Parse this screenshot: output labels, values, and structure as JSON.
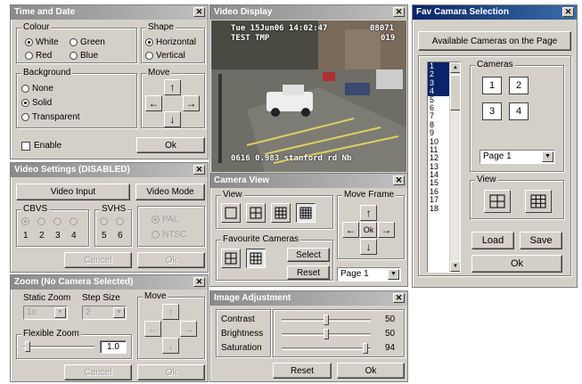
{
  "time_date": {
    "title": "Time and Date",
    "colour_label": "Colour",
    "colours": [
      "White",
      "Green",
      "Red",
      "Blue"
    ],
    "shape_label": "Shape",
    "shapes": [
      "Horizontal",
      "Vertical"
    ],
    "background_label": "Background",
    "backgrounds": [
      "None",
      "Solid",
      "Transparent"
    ],
    "move_label": "Move",
    "enable_label": "Enable",
    "ok_label": "Ok"
  },
  "video_display": {
    "title": "Video Display",
    "overlay_line1": "Tue 15Jun06 14:02:47 ",
    "overlay_line1_right": "08071",
    "overlay_line2": "TEST    TMP",
    "overlay_line2_right": "019",
    "overlay_bottom": "0616  0.983 stanford rd Nb"
  },
  "fav_camera": {
    "title": "Fav Camara Selection",
    "available_button": "Available Cameras on the Page",
    "list_items": [
      "1",
      "2",
      "3",
      "4",
      "5",
      "6",
      "7",
      "8",
      "9",
      "10",
      "11",
      "12",
      "13",
      "14",
      "15",
      "16",
      "17",
      "18"
    ],
    "selected_items": [
      "1",
      "2",
      "3",
      "4"
    ],
    "cameras_label": "Cameras",
    "camera_slots": [
      "1",
      "2",
      "3",
      "4"
    ],
    "page_select": "Page 1",
    "view_label": "View",
    "load_label": "Load",
    "save_label": "Save",
    "ok_label": "Ok"
  },
  "video_settings": {
    "title": "Video Settings (DISABLED)",
    "video_input": "Video Input",
    "video_mode": "Video Mode",
    "cbvs_label": "CBVS",
    "cbvs_numbers": [
      "1",
      "2",
      "3",
      "4"
    ],
    "svhs_label": "SVHS",
    "svhs_numbers": [
      "5",
      "6"
    ],
    "pal_label": "PAL",
    "ntsc_label": "NTSC",
    "cancel_label": "Cancel",
    "ok_label": "Ok"
  },
  "camera_view": {
    "title": "Camera View",
    "view_label": "View",
    "move_frame_label": "Move Frame",
    "ok_label": "Ok",
    "favourite_label": "Favourite Cameras",
    "select_label": "Select",
    "reset_label": "Reset",
    "page_select": "Page  1"
  },
  "zoom": {
    "title": "Zoom (No Camera Selected)",
    "static_zoom_label": "Static Zoom",
    "static_zoom_value": "1x",
    "step_size_label": "Step Size",
    "step_size_value": "2",
    "move_label": "Move",
    "flexible_zoom_label": "Flexible Zoom",
    "flexible_zoom_value": "1.0",
    "cancel_label": "Cancel",
    "ok_label": "Ok"
  },
  "image_adjustment": {
    "title": "Image Adjustment",
    "contrast_label": "Contrast",
    "contrast_value": "50",
    "brightness_label": "Brightness",
    "brightness_value": "50",
    "saturation_label": "Saturation",
    "saturation_value": "94",
    "reset_label": "Reset",
    "ok_label": "Ok"
  }
}
